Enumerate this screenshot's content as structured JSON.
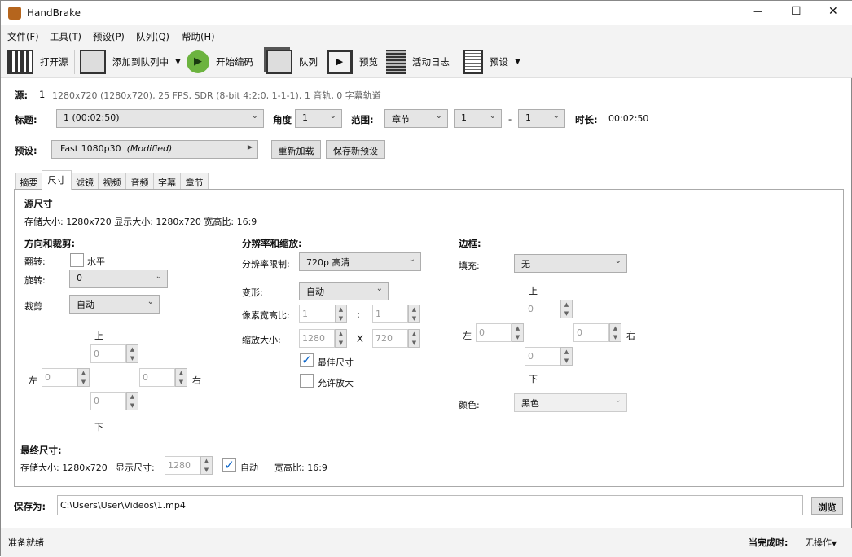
{
  "window": {
    "title": "HandBrake",
    "minimize": "—",
    "maximize": "☐",
    "close": "✕"
  },
  "menu": [
    "文件(F)",
    "工具(T)",
    "预设(P)",
    "队列(Q)",
    "帮助(H)"
  ],
  "toolbar": {
    "open_source": "打开源",
    "add_to_queue": "添加到队列中",
    "start": "开始编码",
    "queue": "队列",
    "preview": "预览",
    "activity_log": "活动日志",
    "presets": "预设"
  },
  "source": {
    "label": "源:",
    "title_no": "1",
    "info": "1280x720 (1280x720), 25 FPS, SDR (8-bit 4:2:0, 1-1-1), 1 音轨, 0 字幕轨道"
  },
  "title_row": {
    "label": "标题:",
    "title": "1  (00:02:50)",
    "angle_label": "角度",
    "angle": "1",
    "range_label": "范围:",
    "range_type": "章节",
    "range_start": "1",
    "dash": "-",
    "range_end": "1",
    "duration_label": "时长:",
    "duration": "00:02:50"
  },
  "preset_row": {
    "label": "预设:",
    "preset": "Fast 1080p30",
    "modified": "(Modified)",
    "reload": "重新加载",
    "save_new": "保存新预设"
  },
  "tabs": [
    "摘要",
    "尺寸",
    "滤镜",
    "视频",
    "音频",
    "字幕",
    "章节"
  ],
  "dimensions": {
    "source_title": "源尺寸",
    "source_info": "存储大小: 1280x720 显示大小: 1280x720 宽高比: 16:9",
    "orient_title": "方向和裁剪:",
    "flip_label": "翻转:",
    "flip_option": "水平",
    "rotate_label": "旋转:",
    "rotate": "0",
    "crop_label": "裁剪",
    "crop": "自动",
    "top": "上",
    "bottom": "下",
    "left": "左",
    "right": "右",
    "crop_top": "0",
    "crop_bottom": "0",
    "crop_left": "0",
    "crop_right": "0",
    "res_title": "分辨率和缩放:",
    "res_limit_label": "分辨率限制:",
    "res_limit": "720p 高清",
    "anamorphic_label": "变形:",
    "anamorphic": "自动",
    "par_label": "像素宽高比:",
    "par_x": "1",
    "colon": ":",
    "par_y": "1",
    "scale_label": "缩放大小:",
    "scale_w": "1280",
    "x": "X",
    "scale_h": "720",
    "best_size": "最佳尺寸",
    "allow_upscale": "允许放大",
    "border_title": "边框:",
    "fill_label": "填充:",
    "fill": "无",
    "pad_top": "0",
    "pad_bottom": "0",
    "pad_left": "0",
    "pad_right": "0",
    "color_label": "颜色:",
    "color": "黑色",
    "final_title": "最终尺寸:",
    "final_storage": "存储大小: 1280x720",
    "display_label": "显示尺寸:",
    "display_w": "1280",
    "auto": "自动",
    "final_aspect": "宽高比: 16:9"
  },
  "save": {
    "label": "保存为:",
    "path": "C:\\Users\\User\\Videos\\1.mp4",
    "browse": "浏览"
  },
  "status": {
    "text": "准备就绪",
    "when_done_label": "当完成时:",
    "when_done": "无操作"
  }
}
